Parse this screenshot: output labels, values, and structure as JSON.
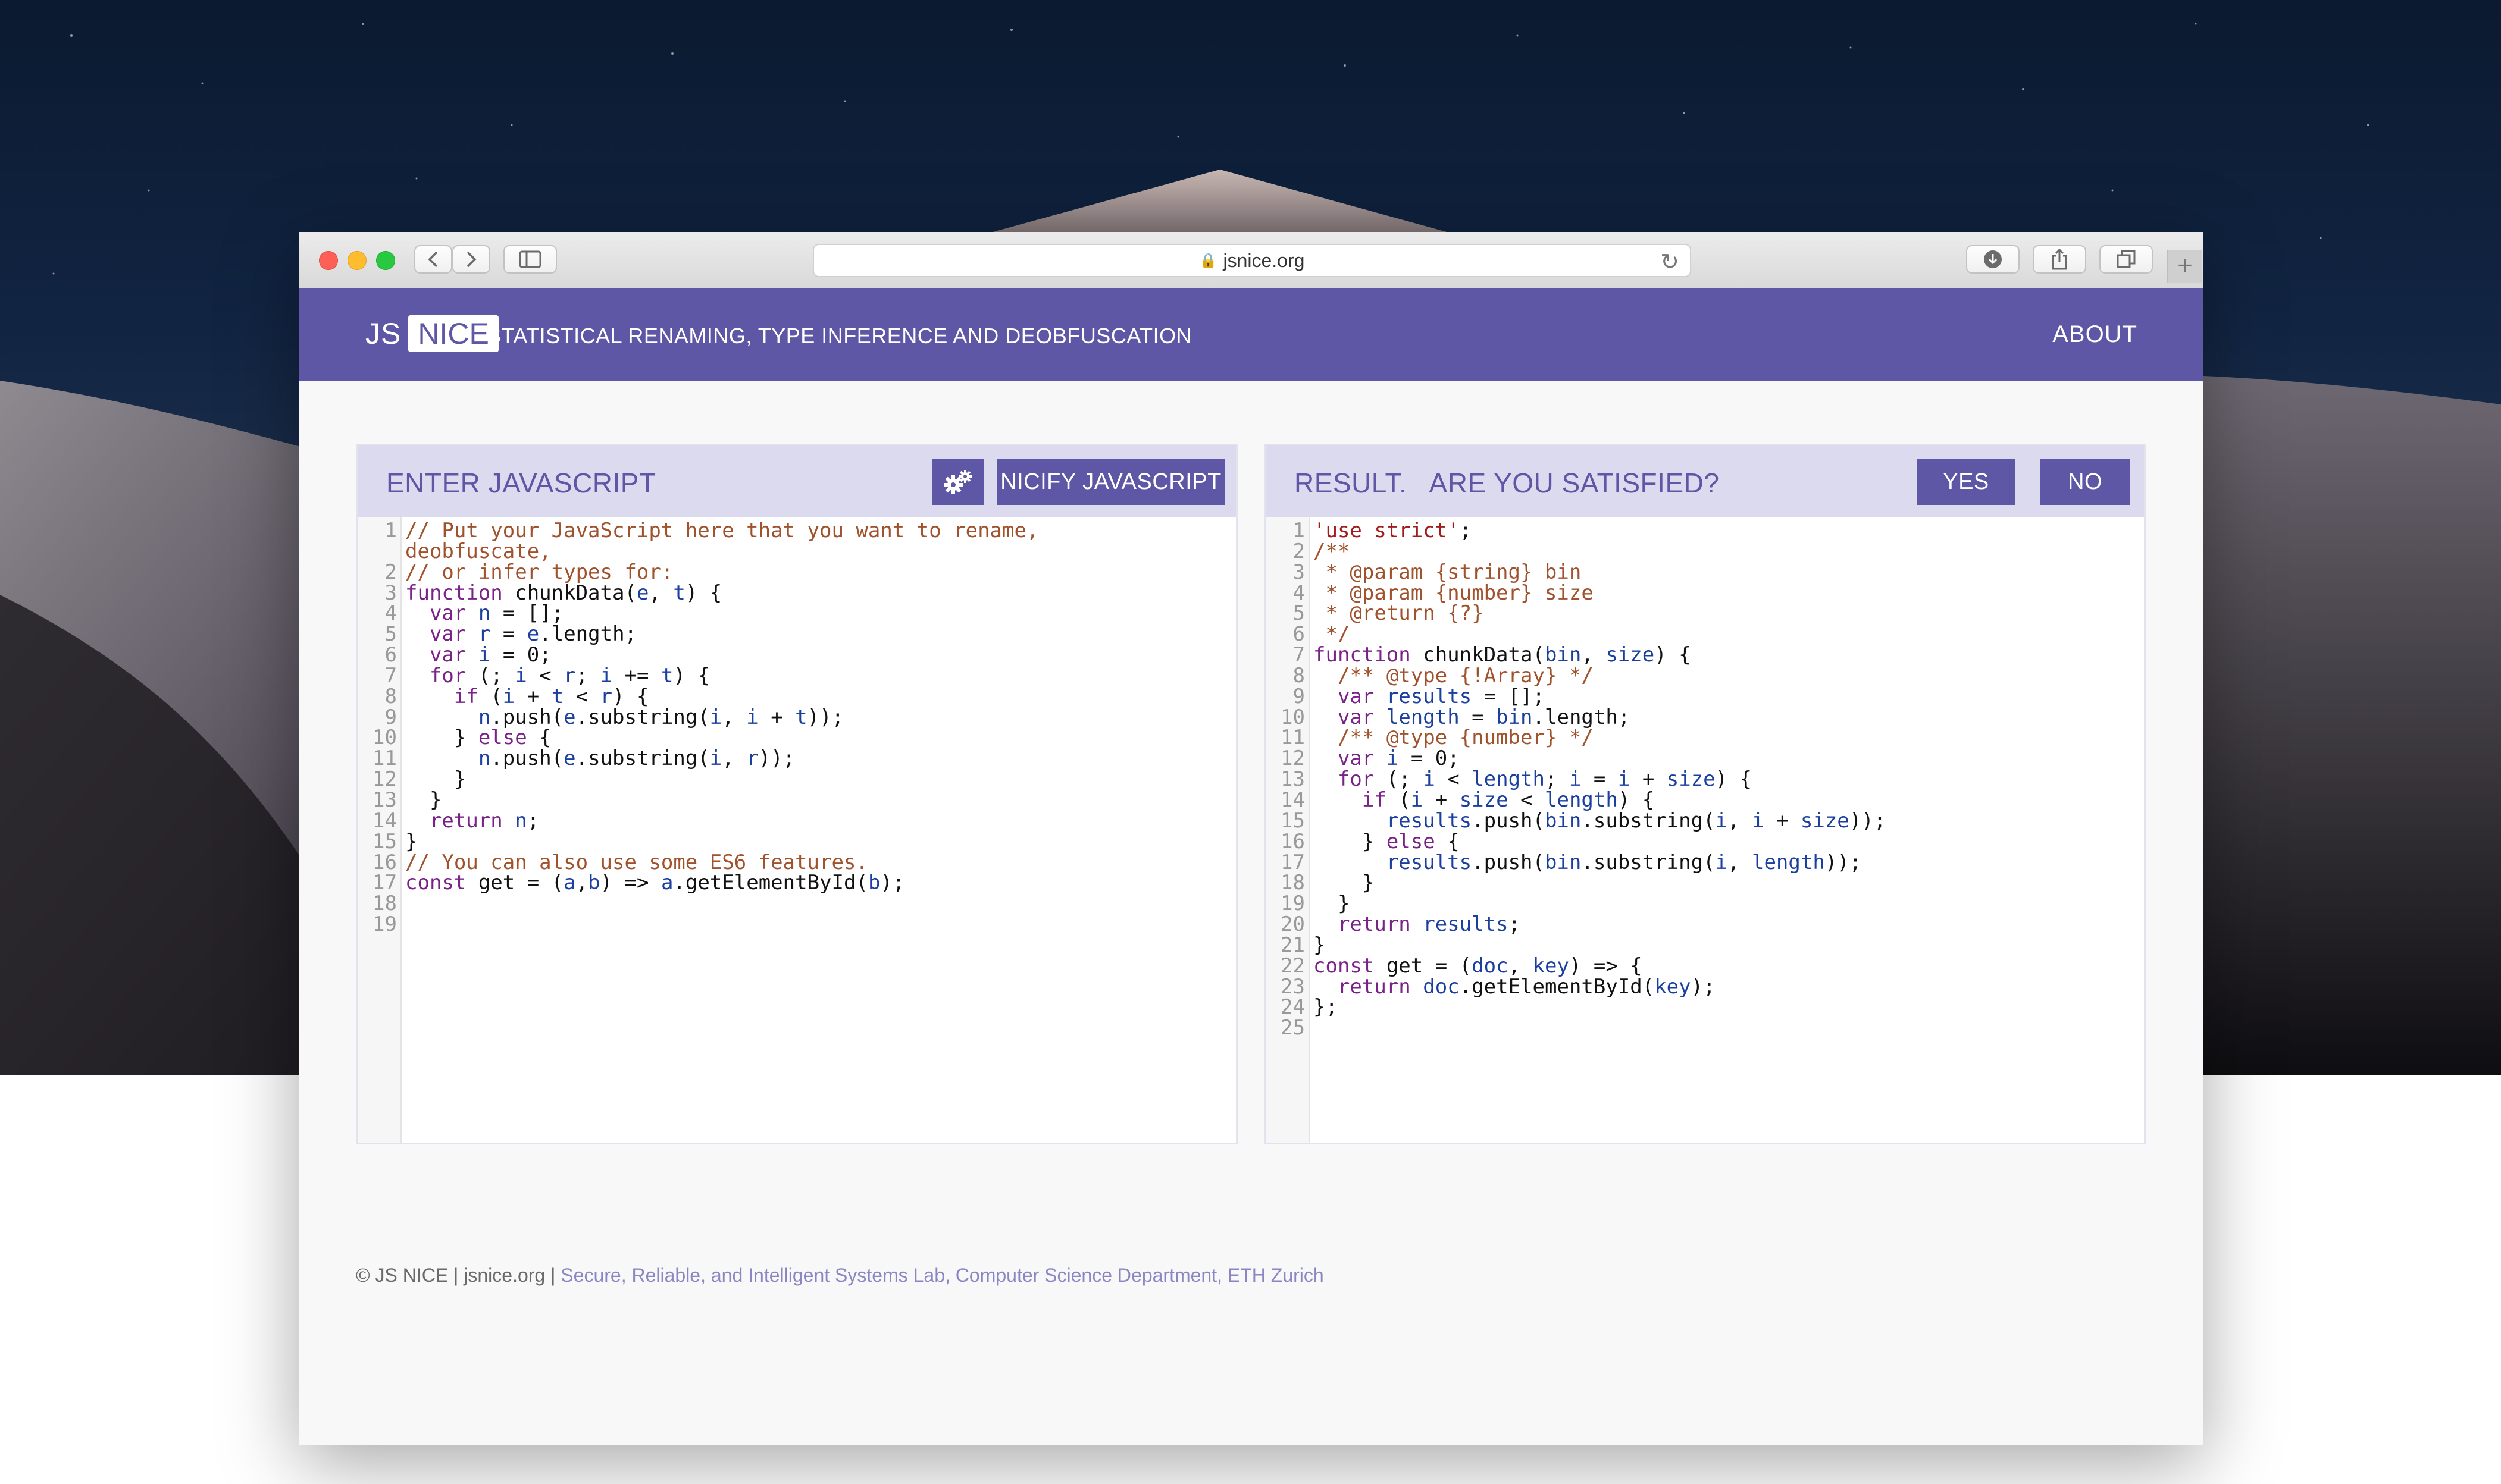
{
  "browser": {
    "url": "jsnice.org",
    "back_icon": "chevron-left",
    "forward_icon": "chevron-right",
    "sidebar_icon": "sidebar",
    "reload_icon": "reload",
    "download_icon": "download",
    "share_icon": "share",
    "tabs_icon": "tabs",
    "newtab_icon": "+"
  },
  "header": {
    "logo_js": "JS",
    "logo_nice": "NICE",
    "tagline": "STATISTICAL RENAMING, TYPE INFERENCE AND DEOBFUSCATION",
    "about": "ABOUT"
  },
  "input_panel": {
    "title": "ENTER JAVASCRIPT",
    "settings_icon": "gears",
    "nicify_button": "NICIFY JAVASCRIPT",
    "lines": [
      [
        [
          "c",
          "// Put your JavaScript here that you want to rename,"
        ]
      ],
      [
        [
          "c",
          "deobfuscate,"
        ]
      ],
      [
        [
          "c",
          "// or infer types for:"
        ]
      ],
      [
        [
          "k",
          "function"
        ],
        [
          "p",
          " chunkData("
        ],
        [
          "v",
          "e"
        ],
        [
          "p",
          ", "
        ],
        [
          "v",
          "t"
        ],
        [
          "p",
          ") {"
        ]
      ],
      [
        [
          "p",
          "  "
        ],
        [
          "k",
          "var"
        ],
        [
          "p",
          " "
        ],
        [
          "v",
          "n"
        ],
        [
          "p",
          " = [];"
        ]
      ],
      [
        [
          "p",
          "  "
        ],
        [
          "k",
          "var"
        ],
        [
          "p",
          " "
        ],
        [
          "v",
          "r"
        ],
        [
          "p",
          " = "
        ],
        [
          "v",
          "e"
        ],
        [
          "p",
          ".length;"
        ]
      ],
      [
        [
          "p",
          "  "
        ],
        [
          "k",
          "var"
        ],
        [
          "p",
          " "
        ],
        [
          "v",
          "i"
        ],
        [
          "p",
          " = 0;"
        ]
      ],
      [
        [
          "p",
          "  "
        ],
        [
          "k",
          "for"
        ],
        [
          "p",
          " (; "
        ],
        [
          "v",
          "i"
        ],
        [
          "p",
          " < "
        ],
        [
          "v",
          "r"
        ],
        [
          "p",
          "; "
        ],
        [
          "v",
          "i"
        ],
        [
          "p",
          " += "
        ],
        [
          "v",
          "t"
        ],
        [
          "p",
          ") {"
        ]
      ],
      [
        [
          "p",
          "    "
        ],
        [
          "k",
          "if"
        ],
        [
          "p",
          " ("
        ],
        [
          "v",
          "i"
        ],
        [
          "p",
          " + "
        ],
        [
          "v",
          "t"
        ],
        [
          "p",
          " < "
        ],
        [
          "v",
          "r"
        ],
        [
          "p",
          ") {"
        ]
      ],
      [
        [
          "p",
          "      "
        ],
        [
          "v",
          "n"
        ],
        [
          "p",
          ".push("
        ],
        [
          "v",
          "e"
        ],
        [
          "p",
          ".substring("
        ],
        [
          "v",
          "i"
        ],
        [
          "p",
          ", "
        ],
        [
          "v",
          "i"
        ],
        [
          "p",
          " + "
        ],
        [
          "v",
          "t"
        ],
        [
          "p",
          "));"
        ]
      ],
      [
        [
          "p",
          "    } "
        ],
        [
          "k",
          "else"
        ],
        [
          "p",
          " {"
        ]
      ],
      [
        [
          "p",
          "      "
        ],
        [
          "v",
          "n"
        ],
        [
          "p",
          ".push("
        ],
        [
          "v",
          "e"
        ],
        [
          "p",
          ".substring("
        ],
        [
          "v",
          "i"
        ],
        [
          "p",
          ", "
        ],
        [
          "v",
          "r"
        ],
        [
          "p",
          "));"
        ]
      ],
      [
        [
          "p",
          "    }"
        ]
      ],
      [
        [
          "p",
          "  }"
        ]
      ],
      [
        [
          "p",
          "  "
        ],
        [
          "k",
          "return"
        ],
        [
          "p",
          " "
        ],
        [
          "v",
          "n"
        ],
        [
          "p",
          ";"
        ]
      ],
      [
        [
          "p",
          "}"
        ]
      ],
      [
        [
          "c",
          "// You can also use some ES6 features."
        ]
      ],
      [
        [
          "k",
          "const"
        ],
        [
          "p",
          " get = ("
        ],
        [
          "v",
          "a"
        ],
        [
          "p",
          ","
        ],
        [
          "v",
          "b"
        ],
        [
          "p",
          ") => "
        ],
        [
          "v",
          "a"
        ],
        [
          "p",
          ".getElementById("
        ],
        [
          "v",
          "b"
        ],
        [
          "p",
          ");"
        ]
      ],
      [],
      []
    ],
    "line_numbers": [
      "1",
      "",
      "2",
      "3",
      "4",
      "5",
      "6",
      "7",
      "8",
      "9",
      "10",
      "11",
      "12",
      "13",
      "14",
      "15",
      "16",
      "17",
      "18",
      "19"
    ]
  },
  "result_panel": {
    "title": "RESULT.   ARE YOU SATISFIED?",
    "yes_button": "YES",
    "no_button": "NO",
    "lines": [
      [
        [
          "s",
          "'use strict'"
        ],
        [
          "p",
          ";"
        ]
      ],
      [
        [
          "c",
          "/**"
        ]
      ],
      [
        [
          "c",
          " * @param {string} bin"
        ]
      ],
      [
        [
          "c",
          " * @param {number} size"
        ]
      ],
      [
        [
          "c",
          " * @return {?}"
        ]
      ],
      [
        [
          "c",
          " */"
        ]
      ],
      [
        [
          "k",
          "function"
        ],
        [
          "p",
          " chunkData("
        ],
        [
          "v",
          "bin"
        ],
        [
          "p",
          ", "
        ],
        [
          "v",
          "size"
        ],
        [
          "p",
          ") {"
        ]
      ],
      [
        [
          "p",
          "  "
        ],
        [
          "c",
          "/** @type {!Array} */"
        ]
      ],
      [
        [
          "p",
          "  "
        ],
        [
          "k",
          "var"
        ],
        [
          "p",
          " "
        ],
        [
          "v",
          "results"
        ],
        [
          "p",
          " = [];"
        ]
      ],
      [
        [
          "p",
          "  "
        ],
        [
          "k",
          "var"
        ],
        [
          "p",
          " "
        ],
        [
          "v",
          "length"
        ],
        [
          "p",
          " = "
        ],
        [
          "v",
          "bin"
        ],
        [
          "p",
          ".length;"
        ]
      ],
      [
        [
          "p",
          "  "
        ],
        [
          "c",
          "/** @type {number} */"
        ]
      ],
      [
        [
          "p",
          "  "
        ],
        [
          "k",
          "var"
        ],
        [
          "p",
          " "
        ],
        [
          "v",
          "i"
        ],
        [
          "p",
          " = 0;"
        ]
      ],
      [
        [
          "p",
          "  "
        ],
        [
          "k",
          "for"
        ],
        [
          "p",
          " (; "
        ],
        [
          "v",
          "i"
        ],
        [
          "p",
          " < "
        ],
        [
          "v",
          "length"
        ],
        [
          "p",
          "; "
        ],
        [
          "v",
          "i"
        ],
        [
          "p",
          " = "
        ],
        [
          "v",
          "i"
        ],
        [
          "p",
          " + "
        ],
        [
          "v",
          "size"
        ],
        [
          "p",
          ") {"
        ]
      ],
      [
        [
          "p",
          "    "
        ],
        [
          "k",
          "if"
        ],
        [
          "p",
          " ("
        ],
        [
          "v",
          "i"
        ],
        [
          "p",
          " + "
        ],
        [
          "v",
          "size"
        ],
        [
          "p",
          " < "
        ],
        [
          "v",
          "length"
        ],
        [
          "p",
          ") {"
        ]
      ],
      [
        [
          "p",
          "      "
        ],
        [
          "v",
          "results"
        ],
        [
          "p",
          ".push("
        ],
        [
          "v",
          "bin"
        ],
        [
          "p",
          ".substring("
        ],
        [
          "v",
          "i"
        ],
        [
          "p",
          ", "
        ],
        [
          "v",
          "i"
        ],
        [
          "p",
          " + "
        ],
        [
          "v",
          "size"
        ],
        [
          "p",
          "));"
        ]
      ],
      [
        [
          "p",
          "    } "
        ],
        [
          "k",
          "else"
        ],
        [
          "p",
          " {"
        ]
      ],
      [
        [
          "p",
          "      "
        ],
        [
          "v",
          "results"
        ],
        [
          "p",
          ".push("
        ],
        [
          "v",
          "bin"
        ],
        [
          "p",
          ".substring("
        ],
        [
          "v",
          "i"
        ],
        [
          "p",
          ", "
        ],
        [
          "v",
          "length"
        ],
        [
          "p",
          "));"
        ]
      ],
      [
        [
          "p",
          "    }"
        ]
      ],
      [
        [
          "p",
          "  }"
        ]
      ],
      [
        [
          "p",
          "  "
        ],
        [
          "k",
          "return"
        ],
        [
          "p",
          " "
        ],
        [
          "v",
          "results"
        ],
        [
          "p",
          ";"
        ]
      ],
      [
        [
          "p",
          "}"
        ]
      ],
      [
        [
          "k",
          "const"
        ],
        [
          "p",
          " get = ("
        ],
        [
          "v",
          "doc"
        ],
        [
          "p",
          ", "
        ],
        [
          "v",
          "key"
        ],
        [
          "p",
          ") => {"
        ]
      ],
      [
        [
          "p",
          "  "
        ],
        [
          "k",
          "return"
        ],
        [
          "p",
          " "
        ],
        [
          "v",
          "doc"
        ],
        [
          "p",
          ".getElementById("
        ],
        [
          "v",
          "key"
        ],
        [
          "p",
          ");"
        ]
      ],
      [
        [
          "p",
          "};"
        ]
      ],
      []
    ],
    "line_numbers": [
      "1",
      "2",
      "3",
      "4",
      "5",
      "6",
      "7",
      "8",
      "9",
      "10",
      "11",
      "12",
      "13",
      "14",
      "15",
      "16",
      "17",
      "18",
      "19",
      "20",
      "21",
      "22",
      "23",
      "24",
      "25"
    ]
  },
  "footer": {
    "copyright": "© JS NICE | jsnice.org | ",
    "lab": "Secure, Reliable, and Intelligent Systems Lab, Computer Science Department, ETH Zurich"
  },
  "colors": {
    "brand": "#5e57a6",
    "panel_header": "#dcdaee",
    "comment": "#a0522d",
    "keyword": "#7a2288",
    "variable": "#1b3f9e",
    "string": "#a11d1d"
  }
}
